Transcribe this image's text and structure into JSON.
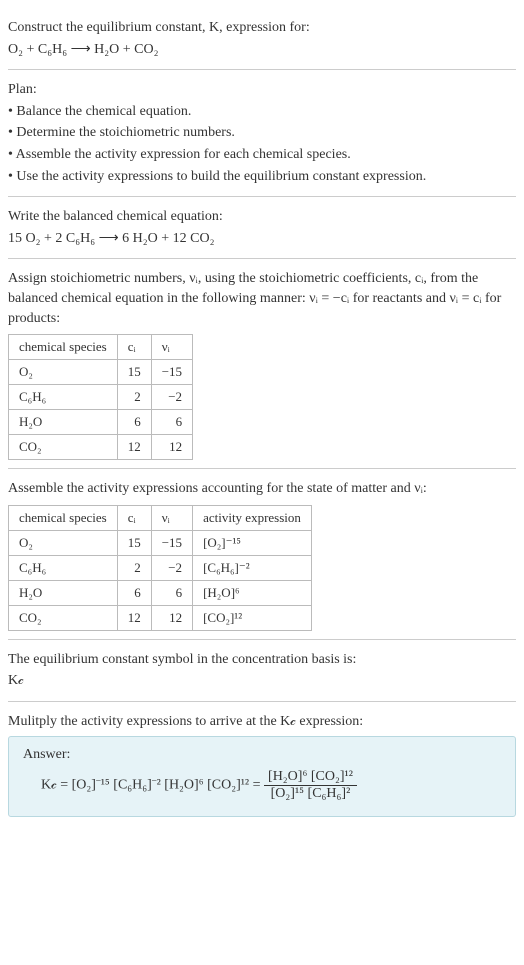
{
  "intro": {
    "line1": "Construct the equilibrium constant, K, expression for:",
    "equation": "O₂ + C₆H₆ ⟶ H₂O + CO₂"
  },
  "plan": {
    "title": "Plan:",
    "b1": "• Balance the chemical equation.",
    "b2": "• Determine the stoichiometric numbers.",
    "b3": "• Assemble the activity expression for each chemical species.",
    "b4": "• Use the activity expressions to build the equilibrium constant expression."
  },
  "balanced": {
    "line1": "Write the balanced chemical equation:",
    "equation": "15 O₂ + 2 C₆H₆ ⟶ 6 H₂O + 12 CO₂"
  },
  "stoich": {
    "line1": "Assign stoichiometric numbers, νᵢ, using the stoichiometric coefficients, cᵢ, from the balanced chemical equation in the following manner: νᵢ = −cᵢ for reactants and νᵢ = cᵢ for products:",
    "headers": {
      "species": "chemical species",
      "c": "cᵢ",
      "v": "νᵢ"
    },
    "rows": [
      {
        "species": "O₂",
        "c": "15",
        "v": "−15"
      },
      {
        "species": "C₆H₆",
        "c": "2",
        "v": "−2"
      },
      {
        "species": "H₂O",
        "c": "6",
        "v": "6"
      },
      {
        "species": "CO₂",
        "c": "12",
        "v": "12"
      }
    ]
  },
  "activity": {
    "line1": "Assemble the activity expressions accounting for the state of matter and νᵢ:",
    "headers": {
      "species": "chemical species",
      "c": "cᵢ",
      "v": "νᵢ",
      "expr": "activity expression"
    },
    "rows": [
      {
        "species": "O₂",
        "c": "15",
        "v": "−15",
        "expr": "[O₂]⁻¹⁵"
      },
      {
        "species": "C₆H₆",
        "c": "2",
        "v": "−2",
        "expr": "[C₆H₆]⁻²"
      },
      {
        "species": "H₂O",
        "c": "6",
        "v": "6",
        "expr": "[H₂O]⁶"
      },
      {
        "species": "CO₂",
        "c": "12",
        "v": "12",
        "expr": "[CO₂]¹²"
      }
    ]
  },
  "ksymbol": {
    "line1": "The equilibrium constant symbol in the concentration basis is:",
    "symbol": "K𝒸"
  },
  "multiply": {
    "line1": "Mulitply the activity expressions to arrive at the K𝒸 expression:",
    "answer_label": "Answer:",
    "lhs": "K𝒸 = [O₂]⁻¹⁵ [C₆H₆]⁻² [H₂O]⁶ [CO₂]¹² = ",
    "frac_num": "[H₂O]⁶ [CO₂]¹²",
    "frac_den": "[O₂]¹⁵ [C₆H₆]²"
  }
}
